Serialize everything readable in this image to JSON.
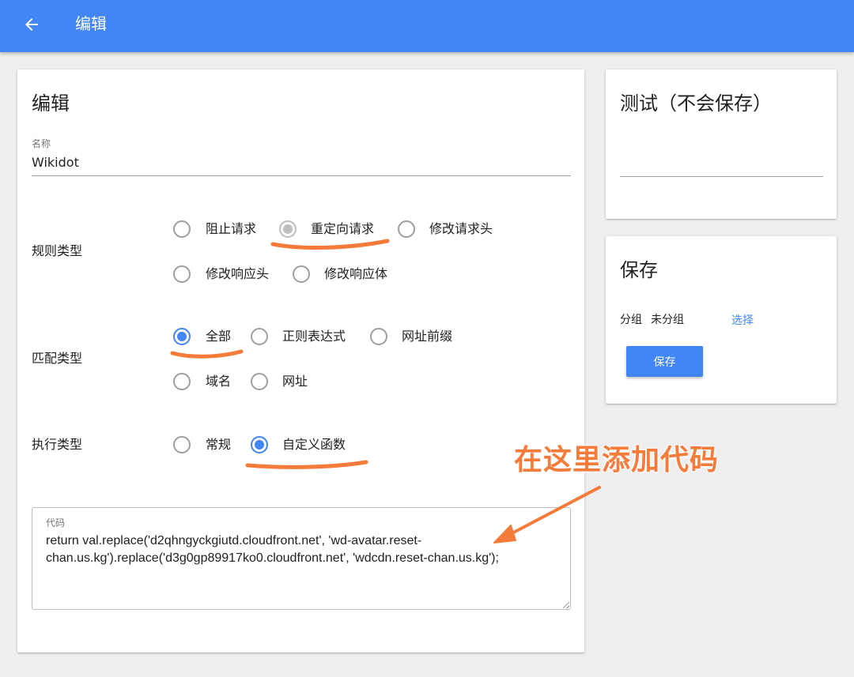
{
  "appbar": {
    "back_icon": "arrow-left-icon",
    "title": "编辑"
  },
  "edit_card": {
    "title": "编辑",
    "name_field": {
      "label": "名称",
      "value": "Wikidot"
    },
    "rule_type": {
      "label": "规则类型",
      "options": [
        "阻止请求",
        "重定向请求",
        "修改请求头",
        "修改响应头",
        "修改响应体"
      ],
      "selected": "重定向请求"
    },
    "match_type": {
      "label": "匹配类型",
      "options": [
        "全部",
        "正则表达式",
        "网址前缀",
        "域名",
        "网址"
      ],
      "selected": "全部"
    },
    "exec_type": {
      "label": "执行类型",
      "options": [
        "常规",
        "自定义函数"
      ],
      "selected": "自定义函数"
    },
    "code": {
      "label": "代码",
      "value": "return val.replace('d2qhngyckgiutd.cloudfront.net', 'wd-avatar.reset-chan.us.kg').replace('d3g0gp89917ko0.cloudfront.net', 'wdcdn.reset-chan.us.kg');"
    }
  },
  "test_card": {
    "title": "测试（不会保存）",
    "input_value": ""
  },
  "save_card": {
    "title": "保存",
    "group_label": "分组",
    "group_value": "未分组",
    "select_label": "选择",
    "save_button": "保存"
  },
  "annotation": {
    "text": "在这里添加代码",
    "color": "#f47b3a"
  },
  "colors": {
    "accent": "#4285f4",
    "annotation": "#f47b3a"
  }
}
